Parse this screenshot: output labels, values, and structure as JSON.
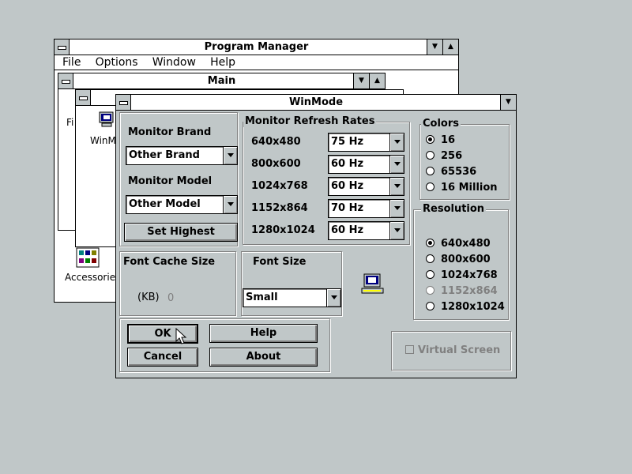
{
  "program_manager": {
    "title": "Program Manager",
    "menu": [
      "File",
      "Options",
      "Window",
      "Help"
    ]
  },
  "main_window": {
    "title": "Main",
    "icons": {
      "accessories": "Accessories",
      "winmode_partial": "WinMo",
      "file_partial": "Fi"
    }
  },
  "winmode": {
    "title": "WinMode",
    "monitor_brand_label": "Monitor Brand",
    "monitor_brand_value": "Other Brand",
    "monitor_model_label": "Monitor Model",
    "monitor_model_value": "Other Model",
    "set_highest": "Set Highest",
    "refresh_group_title": "Monitor Refresh Rates",
    "refresh_rates": [
      {
        "resolution": "640x480",
        "rate": "75 Hz"
      },
      {
        "resolution": "800x600",
        "rate": "60 Hz"
      },
      {
        "resolution": "1024x768",
        "rate": "60 Hz"
      },
      {
        "resolution": "1152x864",
        "rate": "70 Hz"
      },
      {
        "resolution": "1280x1024",
        "rate": "60 Hz"
      }
    ],
    "colors_group_title": "Colors",
    "colors": [
      {
        "label": "16",
        "selected": true
      },
      {
        "label": "256",
        "selected": false
      },
      {
        "label": "65536",
        "selected": false
      },
      {
        "label": "16 Million",
        "selected": false
      }
    ],
    "resolution_group_title": "Resolution",
    "resolutions": [
      {
        "label": "640x480",
        "selected": true,
        "enabled": true
      },
      {
        "label": "800x600",
        "selected": false,
        "enabled": true
      },
      {
        "label": "1024x768",
        "selected": false,
        "enabled": true
      },
      {
        "label": "1152x864",
        "selected": false,
        "enabled": false
      },
      {
        "label": "1280x1024",
        "selected": false,
        "enabled": true
      }
    ],
    "font_cache_label": "Font Cache Size",
    "kb_label": "(KB)",
    "kb_value": "0",
    "font_size_label": "Font Size",
    "font_size_value": "Small",
    "ok": "OK",
    "cancel": "Cancel",
    "help": "Help",
    "about": "About",
    "virtual_screen": "Virtual Screen"
  }
}
